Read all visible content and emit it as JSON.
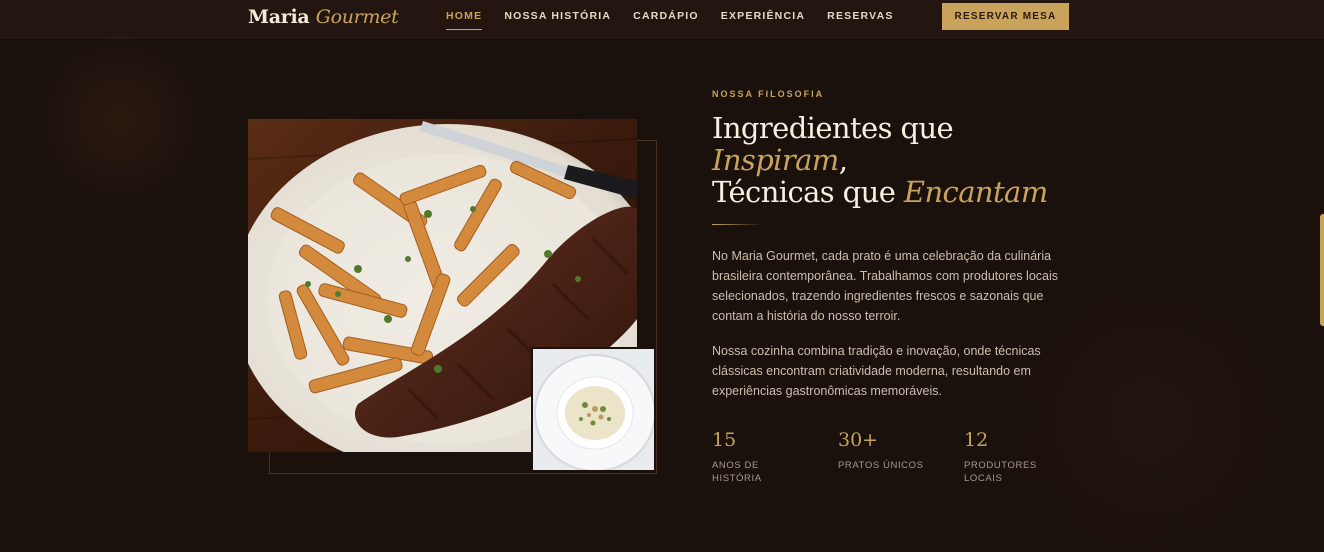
{
  "brand": {
    "name": "Maria",
    "accent": "Gourmet"
  },
  "nav": {
    "links": [
      {
        "label": "HOME",
        "active": true
      },
      {
        "label": "NOSSA HISTÓRIA",
        "active": false
      },
      {
        "label": "CARDÁPIO",
        "active": false
      },
      {
        "label": "EXPERIÊNCIA",
        "active": false
      },
      {
        "label": "RESERVAS",
        "active": false
      }
    ],
    "cta_label": "RESERVAR MESA"
  },
  "about": {
    "eyebrow": "NOSSA FILOSOFIA",
    "headline": {
      "line1": "Ingredientes que",
      "line2_em": "Inspiram",
      "line2_tail": ",",
      "line3_pre": "Técnicas que ",
      "line3_em": "Encantam"
    },
    "paragraph1": "No Maria Gourmet, cada prato é uma celebração da culinária brasileira contemporânea. Trabalhamos com produtores locais selecionados, trazendo ingredientes frescos e sazonais que contam a história do nosso terroir.",
    "paragraph2": "Nossa cozinha combina tradição e inovação, onde técnicas clássicas encontram criatividade moderna, resultando em experiências gastronômicas memoráveis.",
    "stats": [
      {
        "value": "15",
        "label": "ANOS DE HISTÓRIA"
      },
      {
        "value": "30+",
        "label": "PRATOS ÚNICOS"
      },
      {
        "value": "12",
        "label": "PRODUTORES LOCAIS"
      }
    ]
  },
  "images": {
    "main": "steak-frites-photo",
    "inset": "risotto-photo"
  },
  "colors": {
    "background": "#1a100c",
    "nav_background": "#231611",
    "gold_accent": "#c9a35b",
    "text_light": "#f3ead8",
    "text_muted": "#cdbfae"
  }
}
